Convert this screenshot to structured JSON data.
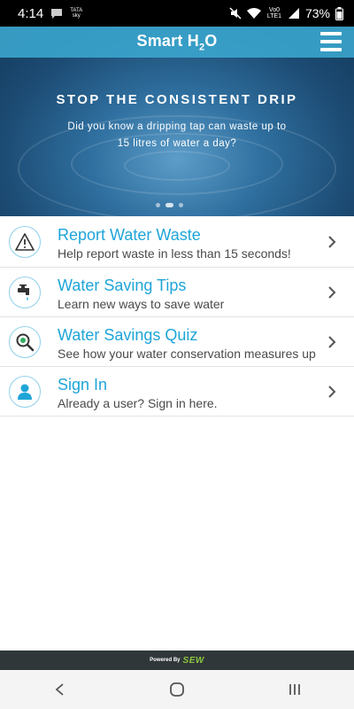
{
  "status_bar": {
    "time": "4:14",
    "carrier_small": "TATA sky",
    "network": "Vo0 LTE1",
    "battery": "73%"
  },
  "header": {
    "title_main": "Smart H",
    "title_sub": "2",
    "title_end": "O",
    "menu_icon": "hamburger-icon"
  },
  "hero": {
    "headline": "STOP THE CONSISTENT DRIP",
    "subtext_line1": "Did you know a dripping tap can waste up to",
    "subtext_line2": "15 litres of water a day?",
    "slide_count": 3,
    "active_slide": 2
  },
  "menu": {
    "items": [
      {
        "title": "Report Water Waste",
        "subtitle": "Help report waste in less than 15 seconds!",
        "icon": "warning-icon"
      },
      {
        "title": "Water Saving Tips",
        "subtitle": "Learn new ways to save water",
        "icon": "tap-icon"
      },
      {
        "title": "Water Savings Quiz",
        "subtitle": "See how your water conservation measures up",
        "icon": "search-icon"
      },
      {
        "title": "Sign In",
        "subtitle": "Already a user? Sign in here.",
        "icon": "user-icon"
      }
    ]
  },
  "footer": {
    "powered_by": "Powered By",
    "brand": "SEW"
  },
  "nav": {
    "back": "back-icon",
    "home": "home-icon",
    "recents": "recents-icon"
  },
  "colors": {
    "accent": "#1ea5d8",
    "header_bg": "#3caad2",
    "footer_bg": "#2f3739"
  }
}
